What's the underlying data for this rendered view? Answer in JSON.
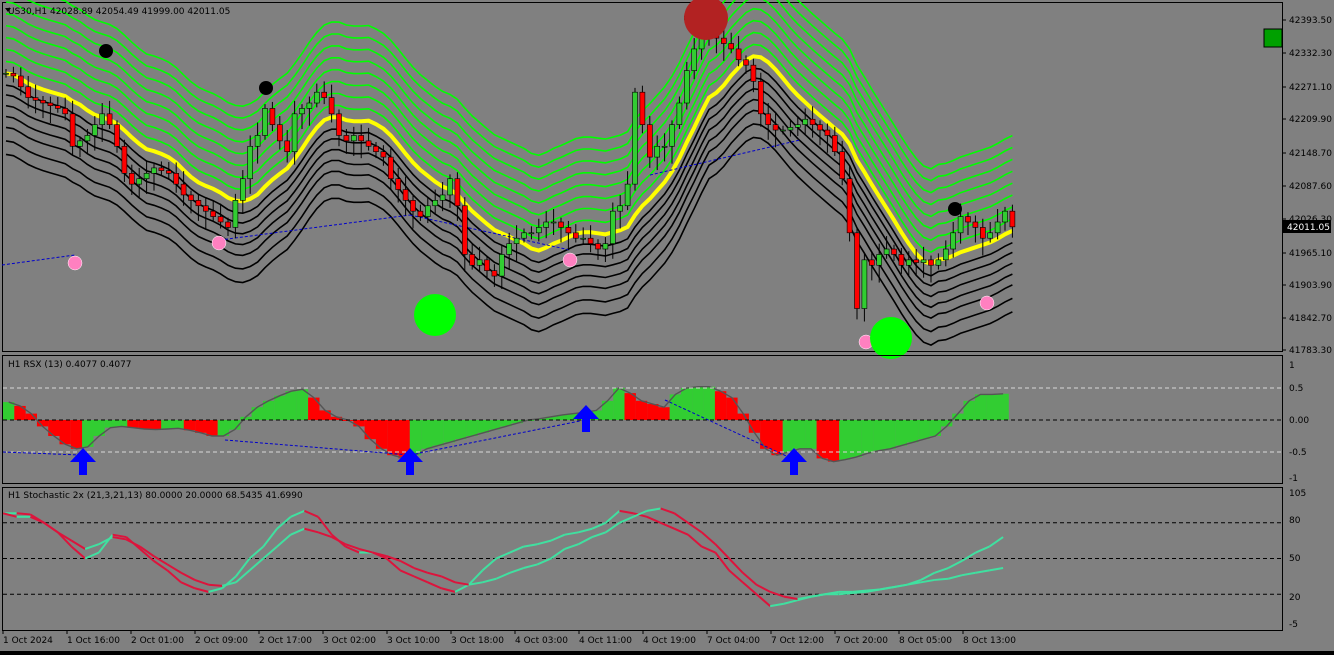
{
  "colors": {
    "background": "#808080",
    "bull_candle": "#32CD32",
    "bear_candle": "#FF0000",
    "wick": "#000000",
    "upper_bands": "#00FF00",
    "middle_band": "#FFFF00",
    "lower_bands": "#000000",
    "price_label_bg": "#000000",
    "rsx_up": "#32CD32",
    "rsx_down": "#FF0000",
    "stoch_main": "#DC143C",
    "stoch_signal": "#40E0A0",
    "arrow": "#0000FF",
    "pink_dot": "#FF80C0",
    "big_green_dot": "#00FF00",
    "big_red_dot": "#B22222",
    "black_dot": "#000000"
  },
  "main_pane": {
    "header": "US30,H1  42028.89 42054.49 41999.00 42011.05",
    "current_price": "42011.05",
    "price_ticks": [
      "42393.50",
      "42332.30",
      "42271.10",
      "42209.90",
      "42148.70",
      "42087.60",
      "42026.30",
      "41965.10",
      "41903.90",
      "41842.70",
      "41783.30"
    ]
  },
  "rsx_pane": {
    "header": "H1  RSX (13) 0.4077 0.4077",
    "ticks": [
      "1",
      "0.5",
      "0.00",
      "-0.5",
      "-1"
    ],
    "levels": [
      0.5,
      0,
      -0.5
    ]
  },
  "stoch_pane": {
    "header": "H1 Stochastic 2x (21,3,21,13) 80.0000 20.0000 68.5435 41.6990",
    "ticks": [
      "105",
      "80",
      "50",
      "20",
      "-5"
    ],
    "levels": [
      80,
      50,
      20
    ]
  },
  "time_axis": {
    "labels": [
      "1 Oct 2024",
      "1 Oct 16:00",
      "2 Oct 01:00",
      "2 Oct 09:00",
      "2 Oct 17:00",
      "3 Oct 02:00",
      "3 Oct 10:00",
      "3 Oct 18:00",
      "4 Oct 03:00",
      "4 Oct 11:00",
      "4 Oct 19:00",
      "7 Oct 04:00",
      "7 Oct 12:00",
      "7 Oct 20:00",
      "8 Oct 05:00",
      "8 Oct 13:00"
    ]
  },
  "chart_data": [
    {
      "type": "candlestick",
      "symbol": "US30",
      "timeframe": "H1",
      "ylim": [
        41783.3,
        42393.5
      ],
      "ohlc_last": {
        "open": 42028.89,
        "high": 42054.49,
        "low": 41999.0,
        "close": 42011.05
      },
      "close": [
        42295,
        42290,
        42270,
        42250,
        42245,
        42240,
        42235,
        42230,
        42220,
        42160,
        42170,
        42180,
        42200,
        42220,
        42200,
        42160,
        42110,
        42090,
        42100,
        42110,
        42120,
        42115,
        42110,
        42090,
        42070,
        42060,
        42050,
        42040,
        42030,
        42020,
        42010,
        42060,
        42100,
        42160,
        42180,
        42230,
        42200,
        42170,
        42150,
        42220,
        42230,
        42240,
        42260,
        42250,
        42220,
        42180,
        42170,
        42180,
        42170,
        42160,
        42150,
        42140,
        42100,
        42080,
        42060,
        42040,
        42030,
        42050,
        42060,
        42070,
        42100,
        42050,
        41960,
        41940,
        41950,
        41930,
        41920,
        41960,
        41980,
        41990,
        42000,
        42000,
        42010,
        42020,
        42020,
        42010,
        42000,
        41990,
        41990,
        41980,
        41970,
        41980,
        42040,
        42050,
        42090,
        42260,
        42200,
        42140,
        42160,
        42160,
        42200,
        42240,
        42300,
        42340,
        42370,
        42380,
        42360,
        42350,
        42340,
        42320,
        42310,
        42280,
        42220,
        42200,
        42190,
        42190,
        42195,
        42200,
        42210,
        42200,
        42190,
        42180,
        42150,
        42100,
        42000,
        41860,
        41950,
        41940,
        41960,
        41970,
        41960,
        41940,
        41950,
        41945,
        41950,
        41940,
        41950,
        41970,
        42000,
        42030,
        42020,
        42010,
        41990,
        42000,
        42020,
        42040,
        42011
      ]
    },
    {
      "type": "line",
      "name": "RSX (13)",
      "ylim": [
        -1,
        1
      ],
      "values": [
        0.28,
        0.22,
        0.1,
        -0.1,
        -0.25,
        -0.38,
        -0.45,
        -0.42,
        -0.25,
        -0.12,
        -0.1,
        -0.12,
        -0.14,
        -0.15,
        -0.14,
        -0.13,
        -0.16,
        -0.2,
        -0.25,
        -0.25,
        -0.15,
        0.05,
        0.2,
        0.3,
        0.38,
        0.45,
        0.48,
        0.35,
        0.15,
        0.05,
        0.0,
        -0.1,
        -0.3,
        -0.45,
        -0.55,
        -0.6,
        -0.55,
        -0.45,
        -0.4,
        -0.35,
        -0.3,
        -0.25,
        -0.2,
        -0.15,
        -0.1,
        -0.05,
        0.0,
        0.02,
        0.05,
        0.08,
        0.1,
        0.12,
        0.15,
        0.3,
        0.5,
        0.42,
        0.3,
        0.25,
        0.2,
        0.4,
        0.5,
        0.52,
        0.52,
        0.45,
        0.35,
        0.1,
        -0.2,
        -0.45,
        -0.55,
        -0.5,
        -0.45,
        -0.45,
        -0.6,
        -0.65,
        -0.62,
        -0.58,
        -0.52,
        -0.48,
        -0.45,
        -0.4,
        -0.35,
        -0.3,
        -0.25,
        -0.1,
        0.1,
        0.3,
        0.4,
        0.4,
        0.41
      ]
    },
    {
      "type": "line",
      "name": "Stochastic 2x",
      "ylim": [
        -5,
        105
      ],
      "series": [
        {
          "values": [
            88,
            88,
            87,
            80,
            72,
            60,
            50,
            55,
            70,
            68,
            58,
            48,
            40,
            30,
            25,
            22,
            25,
            35,
            50,
            60,
            75,
            85,
            90,
            85,
            70,
            60,
            55,
            55,
            50,
            40,
            35,
            30,
            25,
            22,
            28,
            40,
            50,
            55,
            60,
            62,
            65,
            70,
            72,
            75,
            80,
            90,
            88,
            85,
            80,
            75,
            70,
            60,
            55,
            40,
            30,
            20,
            10,
            12,
            15,
            18,
            20,
            22,
            22,
            23,
            24,
            26,
            28,
            30,
            32,
            33,
            36,
            38,
            40,
            42
          ]
        },
        {
          "values": [
            88,
            85,
            85,
            80,
            72,
            65,
            58,
            62,
            68,
            66,
            60,
            52,
            45,
            38,
            32,
            28,
            27,
            30,
            40,
            50,
            60,
            70,
            75,
            72,
            68,
            62,
            58,
            55,
            52,
            48,
            42,
            38,
            35,
            30,
            28,
            30,
            33,
            38,
            42,
            45,
            50,
            58,
            62,
            68,
            72,
            80,
            85,
            90,
            92,
            88,
            80,
            72,
            62,
            50,
            38,
            28,
            22,
            18,
            16,
            18,
            20,
            20,
            21,
            22,
            24,
            26,
            28,
            32,
            38,
            42,
            48,
            55,
            60,
            68
          ]
        }
      ]
    }
  ]
}
